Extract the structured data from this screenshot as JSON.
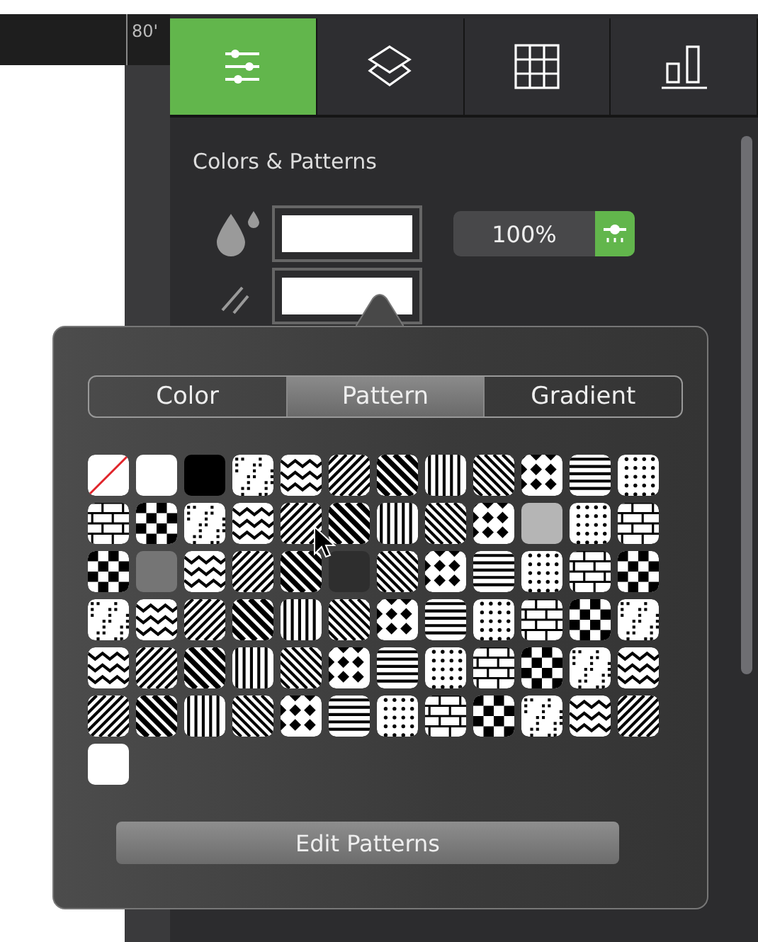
{
  "ruler": {
    "label": "80'"
  },
  "tabs": [
    {
      "selected": true
    },
    {
      "selected": false
    },
    {
      "selected": false
    },
    {
      "selected": false
    }
  ],
  "section_title": "Colors & Patterns",
  "fill": {
    "color": "#ffffff",
    "opacity": "100%"
  },
  "stroke": {
    "color": "#ffffff"
  },
  "popover": {
    "segments": [
      {
        "label": "Color",
        "selected": false
      },
      {
        "label": "Pattern",
        "selected": true
      },
      {
        "label": "Gradient",
        "selected": false
      }
    ],
    "swatches": [
      {
        "kind": "none"
      },
      {
        "kind": "solid",
        "color": "#ffffff"
      },
      {
        "kind": "solid",
        "color": "#000000"
      },
      {
        "kind": "pattern"
      },
      {
        "kind": "pattern"
      },
      {
        "kind": "pattern"
      },
      {
        "kind": "pattern"
      },
      {
        "kind": "pattern"
      },
      {
        "kind": "pattern"
      },
      {
        "kind": "pattern"
      },
      {
        "kind": "pattern"
      },
      {
        "kind": "pattern"
      },
      {
        "kind": "pattern"
      },
      {
        "kind": "pattern"
      },
      {
        "kind": "pattern"
      },
      {
        "kind": "pattern"
      },
      {
        "kind": "pattern"
      },
      {
        "kind": "pattern"
      },
      {
        "kind": "pattern"
      },
      {
        "kind": "pattern"
      },
      {
        "kind": "pattern"
      },
      {
        "kind": "solid",
        "color": "#b5b5b5"
      },
      {
        "kind": "pattern"
      },
      {
        "kind": "pattern"
      },
      {
        "kind": "pattern"
      },
      {
        "kind": "solid",
        "color": "#757575"
      },
      {
        "kind": "pattern"
      },
      {
        "kind": "pattern"
      },
      {
        "kind": "pattern"
      },
      {
        "kind": "solid",
        "color": "#2e2e2e"
      },
      {
        "kind": "pattern"
      },
      {
        "kind": "pattern"
      },
      {
        "kind": "pattern"
      },
      {
        "kind": "pattern"
      },
      {
        "kind": "pattern"
      },
      {
        "kind": "pattern"
      },
      {
        "kind": "pattern"
      },
      {
        "kind": "pattern"
      },
      {
        "kind": "pattern"
      },
      {
        "kind": "pattern"
      },
      {
        "kind": "pattern"
      },
      {
        "kind": "pattern"
      },
      {
        "kind": "pattern"
      },
      {
        "kind": "pattern"
      },
      {
        "kind": "pattern"
      },
      {
        "kind": "pattern"
      },
      {
        "kind": "pattern"
      },
      {
        "kind": "pattern"
      },
      {
        "kind": "pattern"
      },
      {
        "kind": "pattern"
      },
      {
        "kind": "pattern"
      },
      {
        "kind": "pattern"
      },
      {
        "kind": "pattern"
      },
      {
        "kind": "pattern"
      },
      {
        "kind": "pattern"
      },
      {
        "kind": "pattern"
      },
      {
        "kind": "pattern"
      },
      {
        "kind": "pattern"
      },
      {
        "kind": "pattern"
      },
      {
        "kind": "pattern"
      },
      {
        "kind": "pattern"
      },
      {
        "kind": "pattern"
      },
      {
        "kind": "pattern"
      },
      {
        "kind": "pattern"
      },
      {
        "kind": "pattern"
      },
      {
        "kind": "pattern"
      },
      {
        "kind": "pattern"
      },
      {
        "kind": "pattern"
      },
      {
        "kind": "pattern"
      },
      {
        "kind": "pattern"
      },
      {
        "kind": "pattern"
      },
      {
        "kind": "pattern"
      },
      {
        "kind": "solid",
        "color": "#ffffff"
      }
    ],
    "button": "Edit Patterns"
  }
}
